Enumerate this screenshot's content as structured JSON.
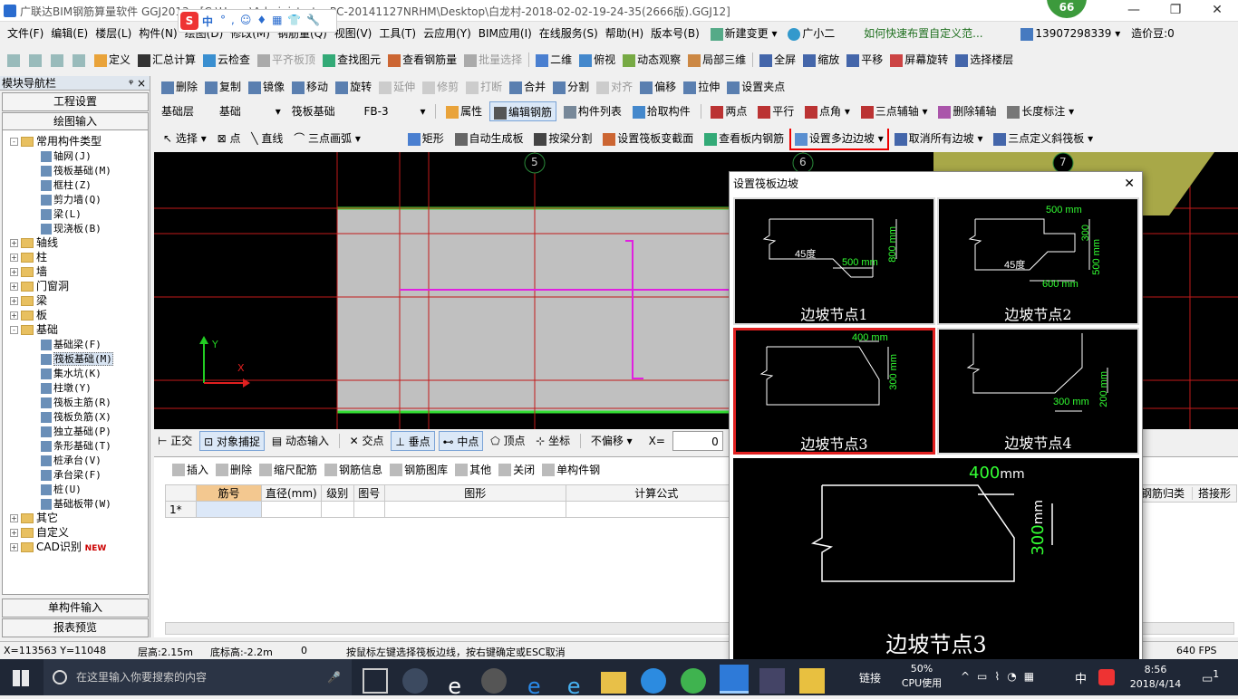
{
  "window": {
    "title": "广联达BIM钢筋算量软件 GGJ2013 - [C:\\Users\\Administrator.PC-20141127NRHM\\Desktop\\白龙村-2018-02-02-19-24-35(2666版).GGJ12]",
    "badge": "66"
  },
  "ime": {
    "text": "中"
  },
  "menu": {
    "items": [
      "文件(F)",
      "编辑(E)",
      "楼层(L)",
      "构件(N)",
      "绘图(D)",
      "修改(M)",
      "钢筋量(Q)",
      "视图(V)",
      "工具(T)",
      "云应用(Y)",
      "BIM应用(I)",
      "在线服务(S)",
      "帮助(H)",
      "版本号(B)"
    ],
    "new_change": "新建变更",
    "assistant": "广小二",
    "tip": "如何快速布置自定义范...",
    "phone": "13907298339",
    "coins": "造价豆:0"
  },
  "toolbar1": [
    "定义",
    "汇总计算",
    "云检查",
    "平齐板顶",
    "查找图元",
    "查看钢筋量",
    "批量选择",
    "二维",
    "俯视",
    "动态观察",
    "局部三维",
    "全屏",
    "缩放",
    "平移",
    "屏幕旋转",
    "选择楼层"
  ],
  "toolbar2": [
    "删除",
    "复制",
    "镜像",
    "移动",
    "旋转",
    "延伸",
    "修剪",
    "打断",
    "合并",
    "分割",
    "对齐",
    "偏移",
    "拉伸",
    "设置夹点"
  ],
  "toolbar3": {
    "floor": "基础层",
    "category": "基础",
    "type": "筏板基础",
    "item": "FB-3",
    "attr": "属性",
    "edit_rebar": "编辑钢筋",
    "list": "构件列表",
    "pick": "拾取构件",
    "two_pt": "两点",
    "parallel": "平行",
    "angle_pt": "点角",
    "three_pt_aux": "三点辅轴",
    "del_aux": "删除辅轴",
    "dim_label": "长度标注"
  },
  "toolbar4": {
    "select": "选择",
    "point": "点",
    "line": "直线",
    "arc": "三点画弧",
    "rect": "矩形",
    "auto_gen": "自动生成板",
    "split_beam": "按梁分割",
    "set_slab_face": "设置筏板变截面",
    "view_rebar": "查看板内钢筋",
    "set_multi_slope": "设置多边边坡",
    "cancel_slope": "取消所有边坡",
    "three_pt_slope": "三点定义斜筏板"
  },
  "left": {
    "header": "模块导航栏",
    "pin": "ᵠ ×",
    "btn_settings": "工程设置",
    "btn_draw": "绘图输入",
    "btn_single": "单构件输入",
    "btn_report": "报表预览",
    "tree": [
      {
        "label": "常用构件类型",
        "level": 0,
        "exp": "-"
      },
      {
        "label": "轴网(J)",
        "level": 1
      },
      {
        "label": "筏板基础(M)",
        "level": 1
      },
      {
        "label": "框柱(Z)",
        "level": 1
      },
      {
        "label": "剪力墙(Q)",
        "level": 1
      },
      {
        "label": "梁(L)",
        "level": 1
      },
      {
        "label": "现浇板(B)",
        "level": 1
      },
      {
        "label": "轴线",
        "level": 0,
        "exp": "+"
      },
      {
        "label": "柱",
        "level": 0,
        "exp": "+"
      },
      {
        "label": "墙",
        "level": 0,
        "exp": "+"
      },
      {
        "label": "门窗洞",
        "level": 0,
        "exp": "+"
      },
      {
        "label": "梁",
        "level": 0,
        "exp": "+"
      },
      {
        "label": "板",
        "level": 0,
        "exp": "+"
      },
      {
        "label": "基础",
        "level": 0,
        "exp": "-"
      },
      {
        "label": "基础梁(F)",
        "level": 1
      },
      {
        "label": "筏板基础(M)",
        "level": 1,
        "selected": true
      },
      {
        "label": "集水坑(K)",
        "level": 1
      },
      {
        "label": "柱墩(Y)",
        "level": 1
      },
      {
        "label": "筏板主筋(R)",
        "level": 1
      },
      {
        "label": "筏板负筋(X)",
        "level": 1
      },
      {
        "label": "独立基础(P)",
        "level": 1
      },
      {
        "label": "条形基础(T)",
        "level": 1
      },
      {
        "label": "桩承台(V)",
        "level": 1
      },
      {
        "label": "承台梁(F)",
        "level": 1
      },
      {
        "label": "桩(U)",
        "level": 1
      },
      {
        "label": "基础板带(W)",
        "level": 1
      },
      {
        "label": "其它",
        "level": 0,
        "exp": "+"
      },
      {
        "label": "自定义",
        "level": 0,
        "exp": "+"
      },
      {
        "label": "CAD识别",
        "level": 0,
        "exp": "+",
        "badge": "NEW"
      }
    ]
  },
  "canvas": {
    "axis5": "5",
    "axis6": "6",
    "axis7": "7",
    "y": "Y",
    "x": "X"
  },
  "lowerbar": [
    "正交",
    "对象捕捉",
    "动态输入",
    "交点",
    "垂点",
    "中点",
    "顶点",
    "坐标",
    "不偏移",
    "X=",
    "0"
  ],
  "table": {
    "toolbar": [
      "插入",
      "删除",
      "缩尺配筋",
      "钢筋信息",
      "钢筋图库",
      "其他",
      "关闭",
      "单构件钢"
    ],
    "headers": [
      "筋号",
      "直径(mm)",
      "级别",
      "图号",
      "图形",
      "计算公式"
    ],
    "right_headers": [
      "钢筋归类",
      "搭接形"
    ],
    "row1": "1*"
  },
  "status": {
    "coords": "X=113563 Y=11048",
    "floor_h": "层高:2.15m",
    "bottom_h": "底标高:-2.2m",
    "zero": "0",
    "hint": "按鼠标左键选择筏板边线，按右键确定或ESC取消",
    "fps": "640 FPS"
  },
  "dialog": {
    "title": "设置筏板边坡",
    "close": "✕",
    "nodes": [
      "边坡节点1",
      "边坡节点2",
      "边坡节点3",
      "边坡节点4"
    ],
    "n1": {
      "a": "45度",
      "w": "500",
      "h": "800",
      "u": "mm"
    },
    "n2": {
      "t": "500",
      "a": "45度",
      "b": "600",
      "h1": "300",
      "h2": "500",
      "u": "mm"
    },
    "n3": {
      "w": "400",
      "h": "300",
      "u": "mm"
    },
    "n4": {
      "w": "300",
      "h": "200",
      "u": "mm"
    },
    "preview": {
      "w": "400",
      "h": "300",
      "u": "mm",
      "label": "边坡节点3"
    }
  },
  "taskbar": {
    "search": "在这里输入你要搜索的内容",
    "link": "链接",
    "cpu": "50%",
    "cpu_label": "CPU使用",
    "ime": "中",
    "time": "8:56",
    "date": "2018/4/14",
    "notif": "1"
  }
}
